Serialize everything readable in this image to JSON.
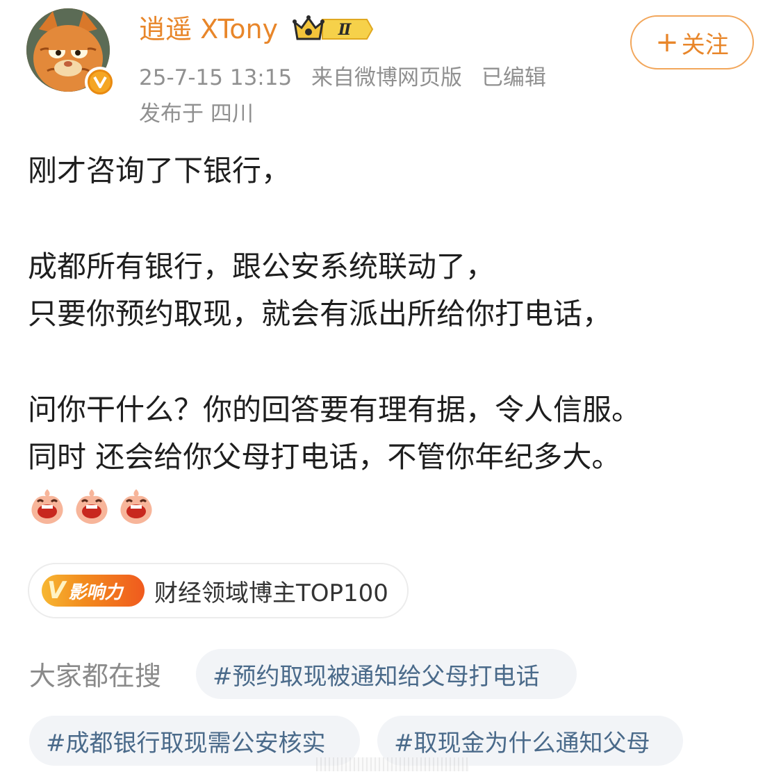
{
  "header": {
    "username": "逍遥 XTony",
    "level_badge_text": "Ⅱ",
    "timestamp": "25-7-15 13:15",
    "source": "来自微博网页版",
    "edited": "已编辑",
    "location": "发布于 四川",
    "follow_label": "关注",
    "follow_icon": "+"
  },
  "post": {
    "lines": [
      "刚才咨询了下银行，",
      "成都所有银行，跟公安系统联动了，",
      "只要你预约取现，就会有派出所给你打电话，",
      "问你干什么？你的回答要有理有据，令人信服。",
      "同时 还会给你父母打电话，不管你年纪多大。"
    ],
    "emoji_icons": [
      "laughing-emoji-icon",
      "laughing-emoji-icon",
      "laughing-emoji-icon"
    ]
  },
  "influence": {
    "logo_text": "影响力",
    "label": "财经领域博主TOP100"
  },
  "search": {
    "label": "大家都在搜",
    "topics": [
      "#预约取现被通知给父母打电话",
      "#成都银行取现需公安核实",
      "#取现金为什么通知父母"
    ]
  },
  "colors": {
    "accent": "#e8862a",
    "topic_text": "#4a6a8a",
    "meta_text": "#909090"
  }
}
